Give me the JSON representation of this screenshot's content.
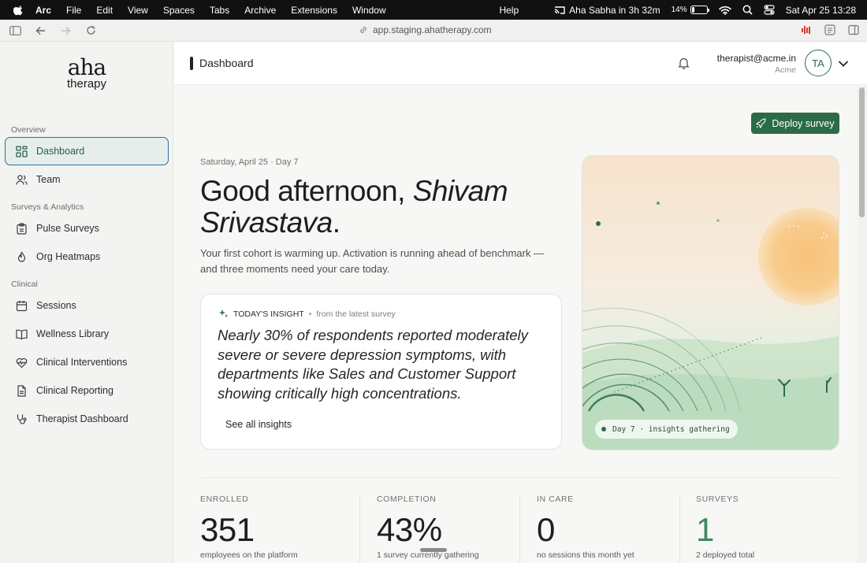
{
  "menubar": {
    "items": [
      "Arc",
      "File",
      "Edit",
      "View",
      "Spaces",
      "Tabs",
      "Archive",
      "Extensions",
      "Window"
    ],
    "help": "Help",
    "event": "Aha Sabha in 3h 32m",
    "battery": "14%",
    "battery_level": 0.14,
    "datetime": "Sat Apr 25  13:28"
  },
  "browser": {
    "url": "app.staging.ahatherapy.com"
  },
  "logo": {
    "line1": "aha",
    "line2": "therapy"
  },
  "sidebar": {
    "sections": [
      {
        "title": "Overview",
        "items": [
          {
            "label": "Dashboard",
            "icon": "grid-icon",
            "active": true
          }
        ]
      },
      {
        "title": "",
        "items": [
          {
            "label": "Team",
            "icon": "users-icon"
          }
        ]
      },
      {
        "title": "Surveys & Analytics",
        "items": [
          {
            "label": "Pulse Surveys",
            "icon": "clipboard-icon"
          },
          {
            "label": "Org Heatmaps",
            "icon": "flame-icon"
          }
        ]
      },
      {
        "title": "Clinical",
        "items": [
          {
            "label": "Sessions",
            "icon": "calendar-icon"
          },
          {
            "label": "Wellness Library",
            "icon": "book-icon"
          },
          {
            "label": "Clinical Interventions",
            "icon": "heart-pulse-icon"
          },
          {
            "label": "Clinical Reporting",
            "icon": "report-icon"
          },
          {
            "label": "Therapist Dashboard",
            "icon": "stethoscope-icon"
          }
        ]
      }
    ]
  },
  "header": {
    "breadcrumb": "Dashboard",
    "user_email": "therapist@acme.in",
    "org": "Acme",
    "avatar_initials": "TA"
  },
  "main": {
    "deploy_label": "Deploy survey",
    "date_line": "Saturday, April 25 · Day 7",
    "greeting_prefix": "Good afternoon, ",
    "greeting_name": "Shivam Srivastava",
    "greeting_suffix": ".",
    "subtitle": "Your first cohort is warming up. Activation is running ahead of benchmark — and three moments need your care today.",
    "insight": {
      "label": "TODAY'S INSIGHT",
      "source": "from the latest survey",
      "quote": "Nearly 30% of respondents reported moderately severe or severe depression symptoms, with departments like Sales and Customer Support showing critically high concentrations.",
      "link": "See all insights"
    },
    "hero_pill": "Day 7 · insights gathering",
    "stats": [
      {
        "label": "ENROLLED",
        "value": "351",
        "caption": "employees on the platform",
        "accent": false
      },
      {
        "label": "COMPLETION",
        "value": "43%",
        "caption": "1 survey currently gathering",
        "accent": false
      },
      {
        "label": "IN CARE",
        "value": "0",
        "caption": "no sessions this month yet",
        "accent": false
      },
      {
        "label": "SURVEYS",
        "value": "1",
        "caption": "2 deployed total",
        "accent": true
      }
    ]
  },
  "colors": {
    "brand_green": "#2c6b47",
    "active_border": "#2f6fa3",
    "accent_value": "#3a8a5e"
  }
}
